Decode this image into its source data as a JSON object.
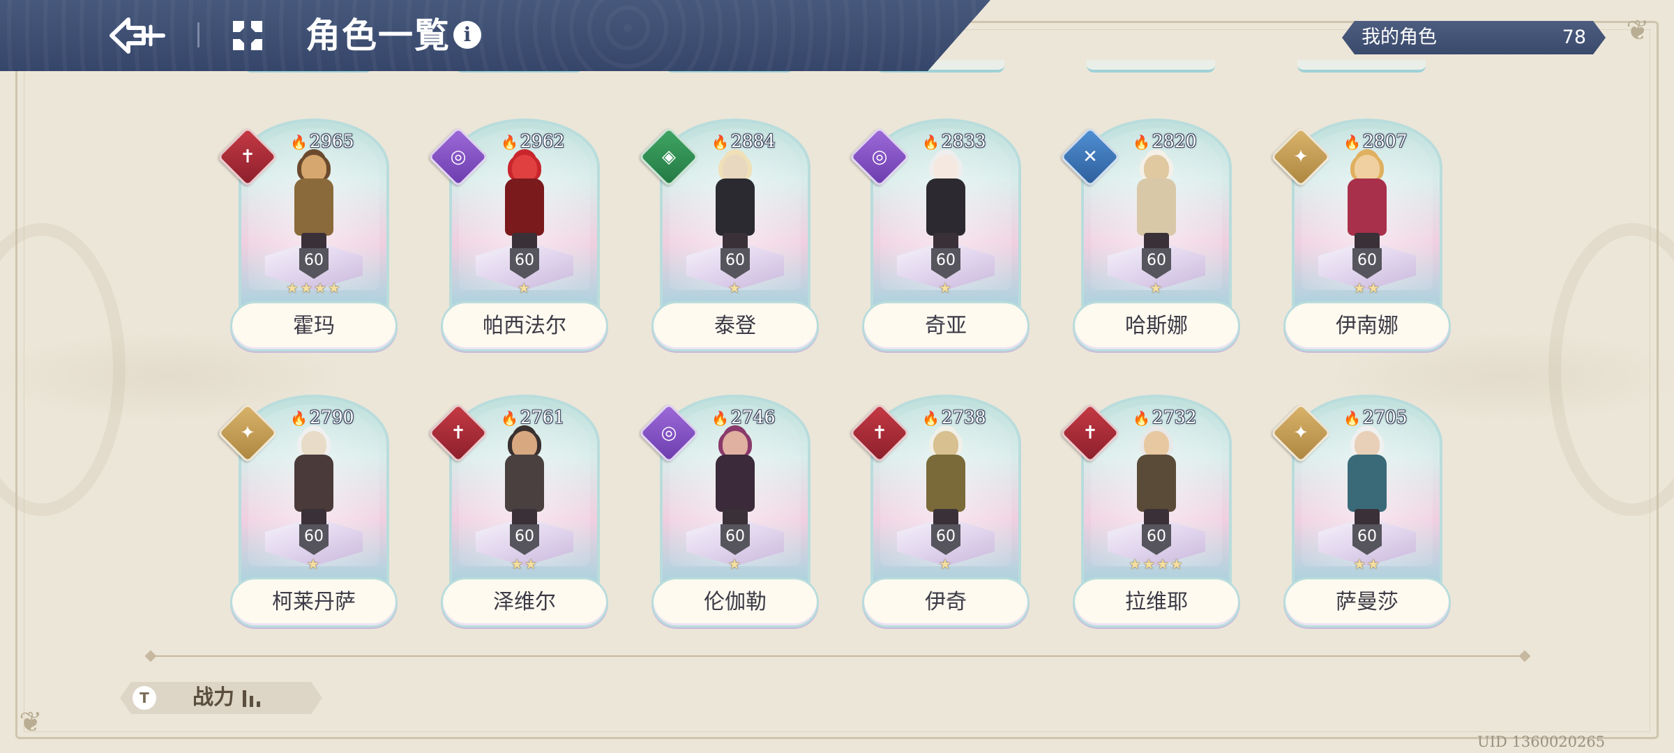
{
  "header": {
    "title": "角色一覧",
    "back_icon": "back-arrow-icon",
    "menu_icon": "grid-menu-icon",
    "info_icon": "info-icon",
    "info_glyph": "i"
  },
  "owned": {
    "label": "我的角色",
    "count": "78"
  },
  "characters": [
    {
      "name": "霍玛",
      "power": "2965",
      "level": "60",
      "stars": "★★★★",
      "element": "fire"
    },
    {
      "name": "帕西法尔",
      "power": "2962",
      "level": "60",
      "stars": "★",
      "element": "arcane"
    },
    {
      "name": "泰登",
      "power": "2884",
      "level": "60",
      "stars": "★",
      "element": "nature"
    },
    {
      "name": "奇亚",
      "power": "2833",
      "level": "60",
      "stars": "★",
      "element": "arcane"
    },
    {
      "name": "哈斯娜",
      "power": "2820",
      "level": "60",
      "stars": "★",
      "element": "water"
    },
    {
      "name": "伊南娜",
      "power": "2807",
      "level": "60",
      "stars": "★★",
      "element": "light"
    },
    {
      "name": "柯莱丹萨",
      "power": "2790",
      "level": "60",
      "stars": "★",
      "element": "light"
    },
    {
      "name": "泽维尔",
      "power": "2761",
      "level": "60",
      "stars": "★★",
      "element": "fire"
    },
    {
      "name": "伦伽勒",
      "power": "2746",
      "level": "60",
      "stars": "★",
      "element": "arcane"
    },
    {
      "name": "伊奇",
      "power": "2738",
      "level": "60",
      "stars": "★",
      "element": "fire"
    },
    {
      "name": "拉维耶",
      "power": "2732",
      "level": "60",
      "stars": "★★★★",
      "element": "fire"
    },
    {
      "name": "萨曼莎",
      "power": "2705",
      "level": "60",
      "stars": "★★",
      "element": "light"
    }
  ],
  "sort": {
    "label": "战力",
    "icon": "filter-icon",
    "glyph": "T"
  },
  "uid": "UID 1360020265",
  "colors": {
    "header": "#3a4a6c",
    "background": "#ece6d8"
  }
}
